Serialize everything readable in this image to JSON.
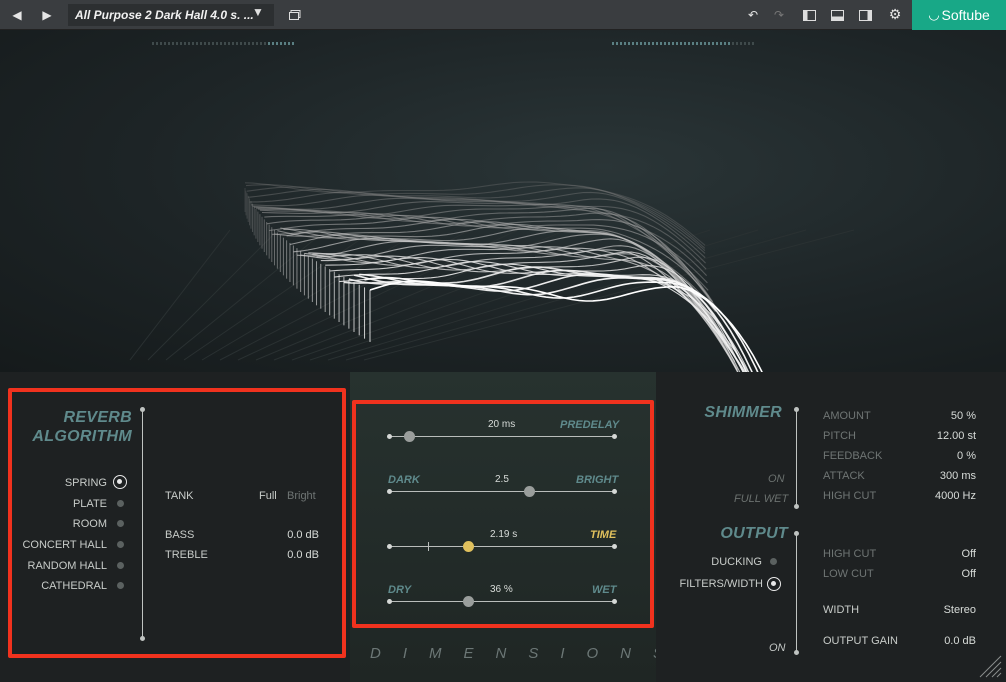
{
  "topbar": {
    "prev_icon": "arrow-left-icon",
    "next_icon": "arrow-right-icon",
    "preset_name": "All Purpose 2 Dark Hall 4.0 s. ...",
    "brand": "Softube"
  },
  "algorithm": {
    "title_line1": "REVERB",
    "title_line2": "ALGORITHM",
    "options": [
      "SPRING",
      "PLATE",
      "ROOM",
      "CONCERT HALL",
      "RANDOM HALL",
      "CATHEDRAL"
    ],
    "selected": "SPRING",
    "tank_label": "TANK",
    "tank_options": [
      "Full",
      "Bright"
    ],
    "tank_selected": "Full",
    "bass_label": "BASS",
    "bass_value": "0.0 dB",
    "treble_label": "TREBLE",
    "treble_value": "0.0 dB"
  },
  "dimensions": {
    "predelay_label": "PREDELAY",
    "predelay_value": "20 ms",
    "dark_label": "DARK",
    "bright_label": "BRIGHT",
    "tone_value": "2.5",
    "time_label": "TIME",
    "time_value": "2.19 s",
    "dry_label": "DRY",
    "wet_label": "WET",
    "mix_value": "36 %",
    "footer": "DIMENSIONS"
  },
  "shimmer": {
    "title": "SHIMMER",
    "on_label": "ON",
    "fullwet_label": "FULL WET",
    "params": [
      {
        "label": "AMOUNT",
        "value": "50 %"
      },
      {
        "label": "PITCH",
        "value": "12.00 st"
      },
      {
        "label": "FEEDBACK",
        "value": "0 %"
      },
      {
        "label": "ATTACK",
        "value": "300 ms"
      },
      {
        "label": "HIGH CUT",
        "value": "4000 Hz"
      }
    ]
  },
  "output": {
    "title": "OUTPUT",
    "ducking_label": "DUCKING",
    "filters_label": "FILTERS/WIDTH",
    "on_label": "ON",
    "high_cut_label": "HIGH CUT",
    "high_cut_value": "Off",
    "low_cut_label": "LOW CUT",
    "low_cut_value": "Off",
    "width_label": "WIDTH",
    "width_value": "Stereo",
    "gain_label": "OUTPUT GAIN",
    "gain_value": "0.0 dB"
  },
  "colors": {
    "accent": "#5f8a8c",
    "highlight": "#e0c15d",
    "brand": "#18a887",
    "annotation": "#f0321e"
  }
}
